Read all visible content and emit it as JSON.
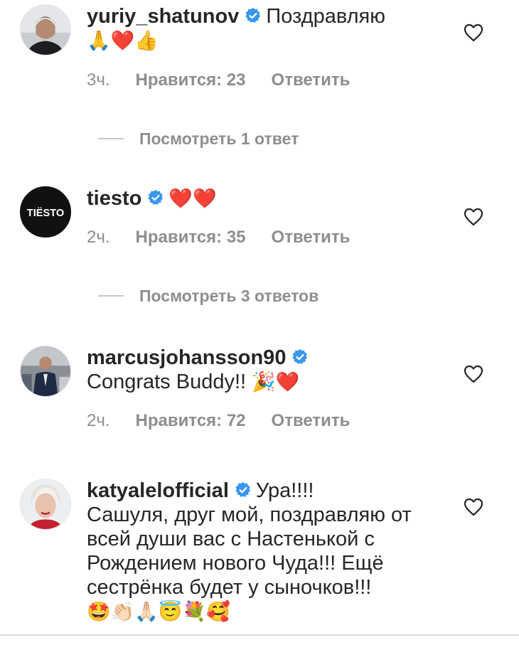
{
  "comments": [
    {
      "username": "yuriy_shatunov",
      "text": "Поздравляю",
      "emojis": "🙏❤️👍",
      "time": "3ч.",
      "likes": "Нравится: 23",
      "reply": "Ответить",
      "view_replies": "Посмотреть 1 ответ"
    },
    {
      "username": "tiesto",
      "text": "",
      "emojis": "❤️❤️",
      "avatar_text": "TIËSTO",
      "time": "2ч.",
      "likes": "Нравится: 35",
      "reply": "Ответить",
      "view_replies": "Посмотреть 3 ответов"
    },
    {
      "username": "marcusjohansson90",
      "text": "Congrats Buddy!!",
      "emojis": "🎉❤️",
      "time": "2ч.",
      "likes": "Нравится: 72",
      "reply": "Ответить"
    },
    {
      "username": "katyalelofficial",
      "text_first": "Ура!!!!",
      "text_rest": "Сашуля, друг мой, поздравляю от всей души вас с Настенькой с Рождением нового Чуда!!! Ещё сестрёнка будет у сыночков!!!",
      "emojis": "🤩👏🏻🙏🏻😇💐🥰"
    }
  ],
  "colors": {
    "text": "#262626",
    "meta": "#8e8e8e",
    "verified": "#3897f0",
    "divider": "#dbdbdb"
  },
  "icons": {
    "verified": "verified-badge-icon",
    "like": "heart-outline-icon"
  }
}
